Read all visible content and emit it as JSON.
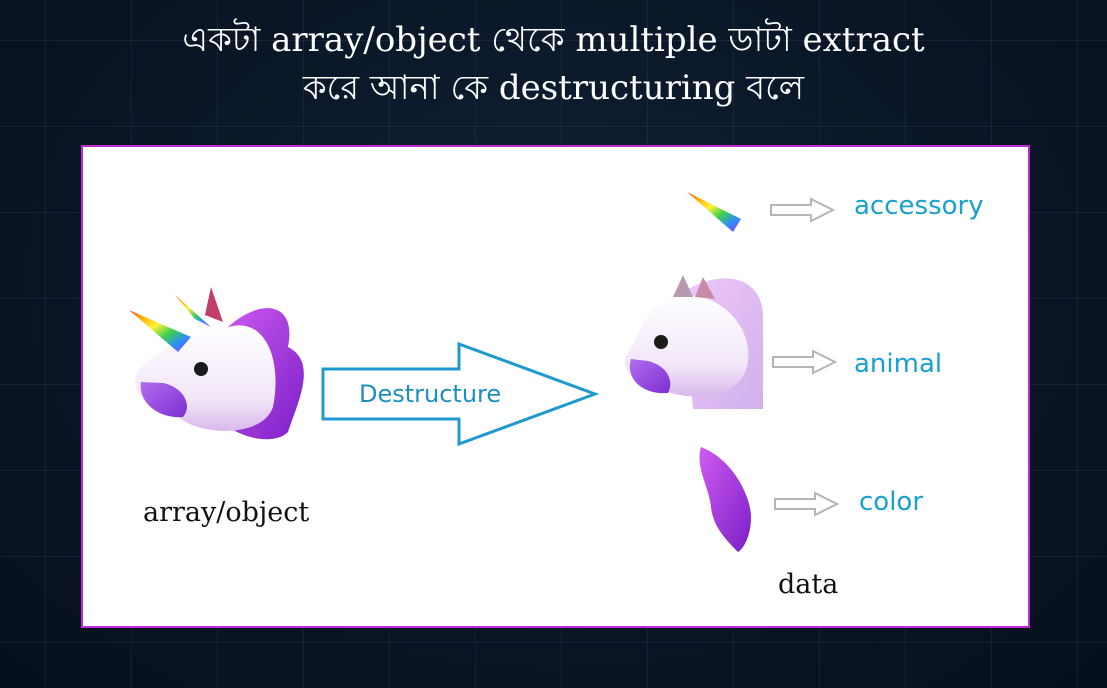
{
  "title": {
    "line1": "একটা array/object থেকে multiple ডাটা extract",
    "line2": "করে আনা কে destructuring বলে"
  },
  "diagram": {
    "source_caption": "array/object",
    "arrow_label": "Destructure",
    "outputs": [
      {
        "label": "accessory",
        "icon": "unicorn-horn-icon"
      },
      {
        "label": "animal",
        "icon": "horse-head-icon"
      },
      {
        "label": "color",
        "icon": "purple-mane-icon"
      }
    ],
    "output_caption": "data"
  },
  "colors": {
    "panel_border": "#c02ad6",
    "accent_blue": "#1aa0d0",
    "mane_purple": "#a34de0"
  }
}
